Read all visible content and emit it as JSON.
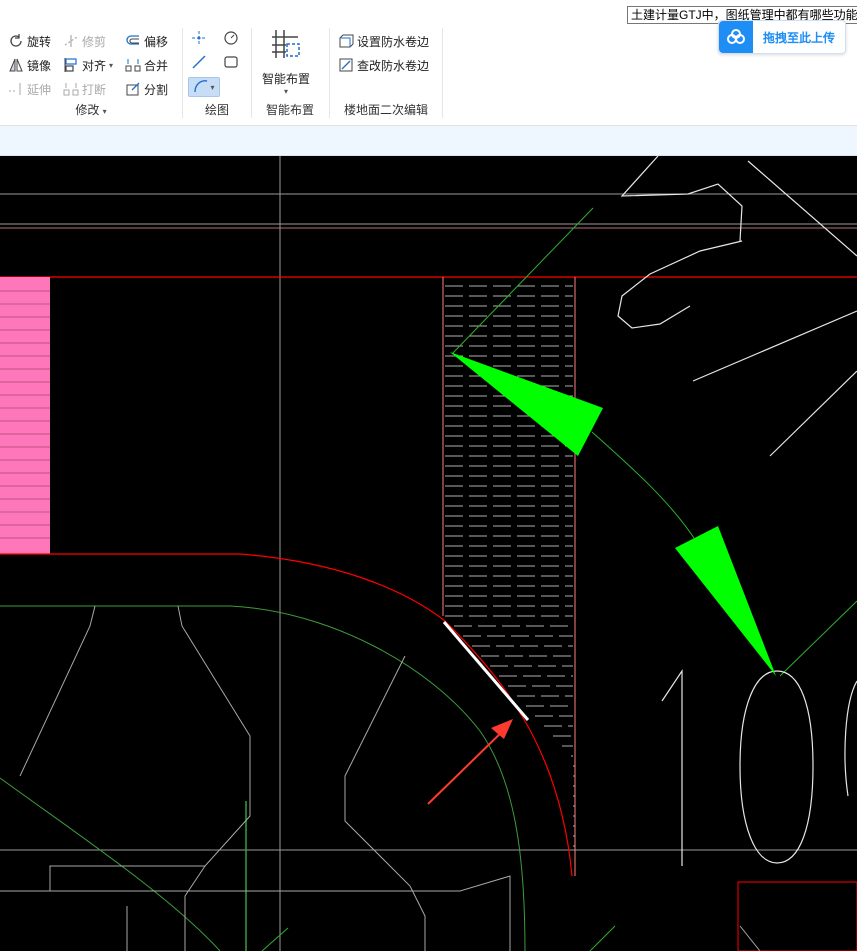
{
  "tooltip": "土建计量GTJ中，图纸管理中都有哪些功能",
  "upload_button": {
    "label": "拖拽至此上传",
    "icon": "cloud-upload-icon",
    "accent": "#1e8ef5"
  },
  "ribbon": {
    "modify": {
      "title": "修改",
      "rotate": "旋转",
      "trim": "修剪",
      "offset": "偏移",
      "mirror": "镜像",
      "align": "对齐",
      "merge": "合并",
      "extend": "延伸",
      "break": "打断",
      "split": "分割"
    },
    "draw": {
      "title": "绘图"
    },
    "smart_layout": {
      "title": "智能布置",
      "button": "智能布置"
    },
    "floor_edit": {
      "title": "楼地面二次编辑",
      "set_edge": "设置防水卷边",
      "check_edge": "查改防水卷边"
    }
  },
  "colors": {
    "canvas_bg": "#000000",
    "wall_red": "#ff0000",
    "hatch_pink": "#ff77bb",
    "arrow_green": "#00ff00",
    "annotation_red": "#ff3b2f",
    "ribbon_accent": "#1e8ef5"
  }
}
